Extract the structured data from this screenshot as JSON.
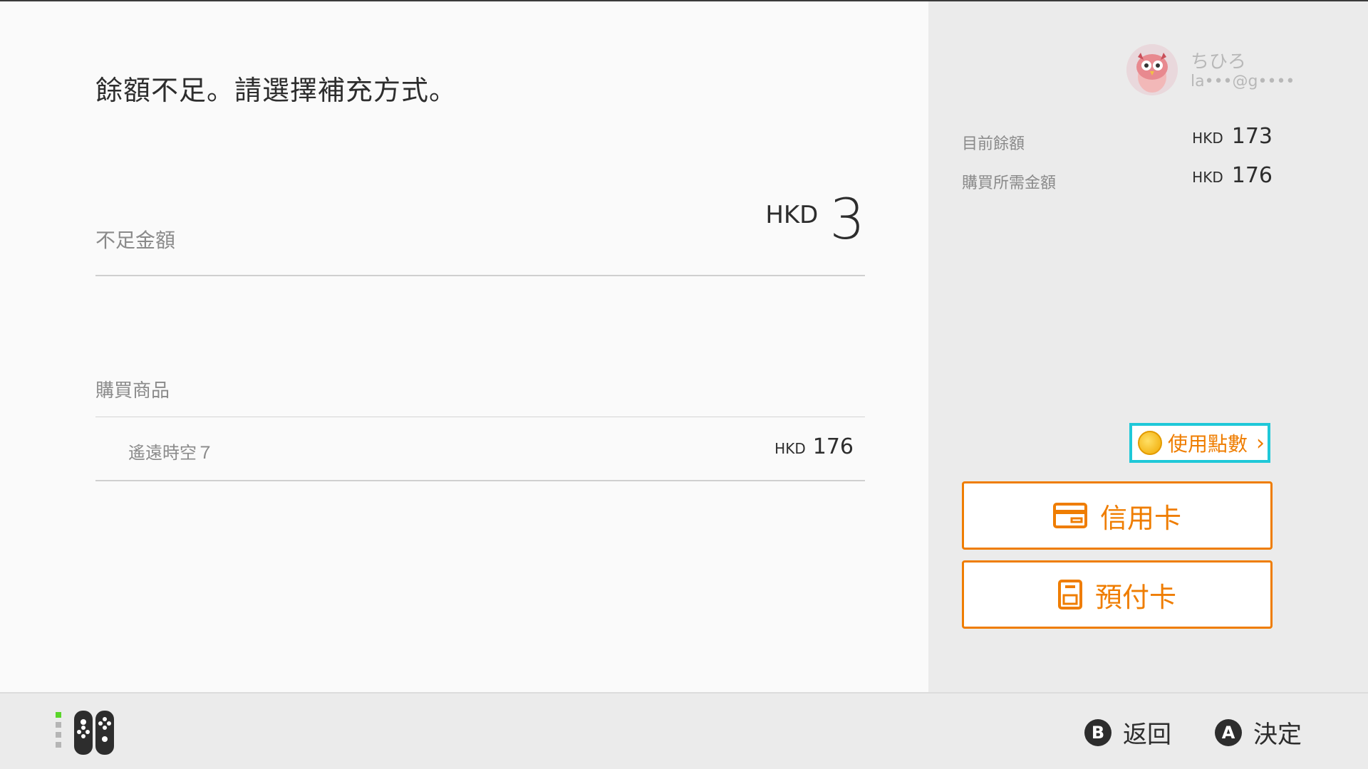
{
  "headline": "餘額不足。請選擇補充方式。",
  "shortfall": {
    "label": "不足金額",
    "currency": "HKD",
    "amount": "3"
  },
  "items": {
    "label": "購買商品",
    "rows": [
      {
        "name": "遙遠時空７",
        "currency": "HKD",
        "price": "176"
      }
    ]
  },
  "account": {
    "name": "ちひろ",
    "email": "la•••@g••••"
  },
  "balance": {
    "current_label": "目前餘額",
    "current_currency": "HKD",
    "current_value": "173",
    "required_label": "購買所需金額",
    "required_currency": "HKD",
    "required_value": "176"
  },
  "actions": {
    "use_points": "使用點數",
    "credit_card": "信用卡",
    "prepaid_card": "預付卡"
  },
  "footer": {
    "back_key": "B",
    "back_label": "返回",
    "confirm_key": "A",
    "confirm_label": "決定"
  },
  "colors": {
    "accent_orange": "#ef7d00",
    "focus_cyan": "#1fc8d8",
    "text_dark": "#2d2d2d",
    "text_muted": "#8a8a8a"
  },
  "icons": {
    "points": "coin-icon",
    "credit_card": "credit-card-icon",
    "prepaid_card": "prepaid-card-icon",
    "chevron": "chevron-right-icon",
    "controller": "joycon-icon"
  }
}
